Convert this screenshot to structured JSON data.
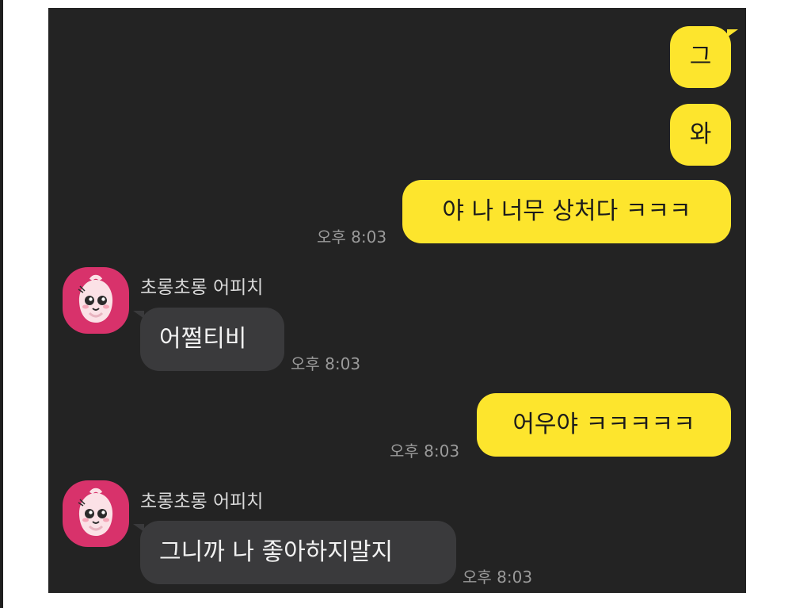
{
  "colors": {
    "chat_background": "#232323",
    "my_bubble": "#fde52d",
    "their_bubble": "#3a3a3c",
    "avatar_background": "#d8326b",
    "timestamp_text": "#9a9a9a"
  },
  "messages": {
    "m1": {
      "text": "그"
    },
    "m2": {
      "text": "와"
    },
    "m3": {
      "text": "야 나 너무 상처다 ㅋㅋㅋ",
      "time": "오후 8:03"
    },
    "m4": {
      "sender": "초롱초롱 어피치",
      "avatar_icon": "apeach-avatar-icon",
      "text": "어쩔티비",
      "time": "오후 8:03"
    },
    "m5": {
      "text": "어우야 ㅋㅋㅋㅋㅋ",
      "time": "오후 8:03"
    },
    "m6": {
      "sender": "초롱초롱 어피치",
      "avatar_icon": "apeach-avatar-icon",
      "text": "그니까 나 좋아하지말지",
      "time": "오후 8:03"
    }
  }
}
